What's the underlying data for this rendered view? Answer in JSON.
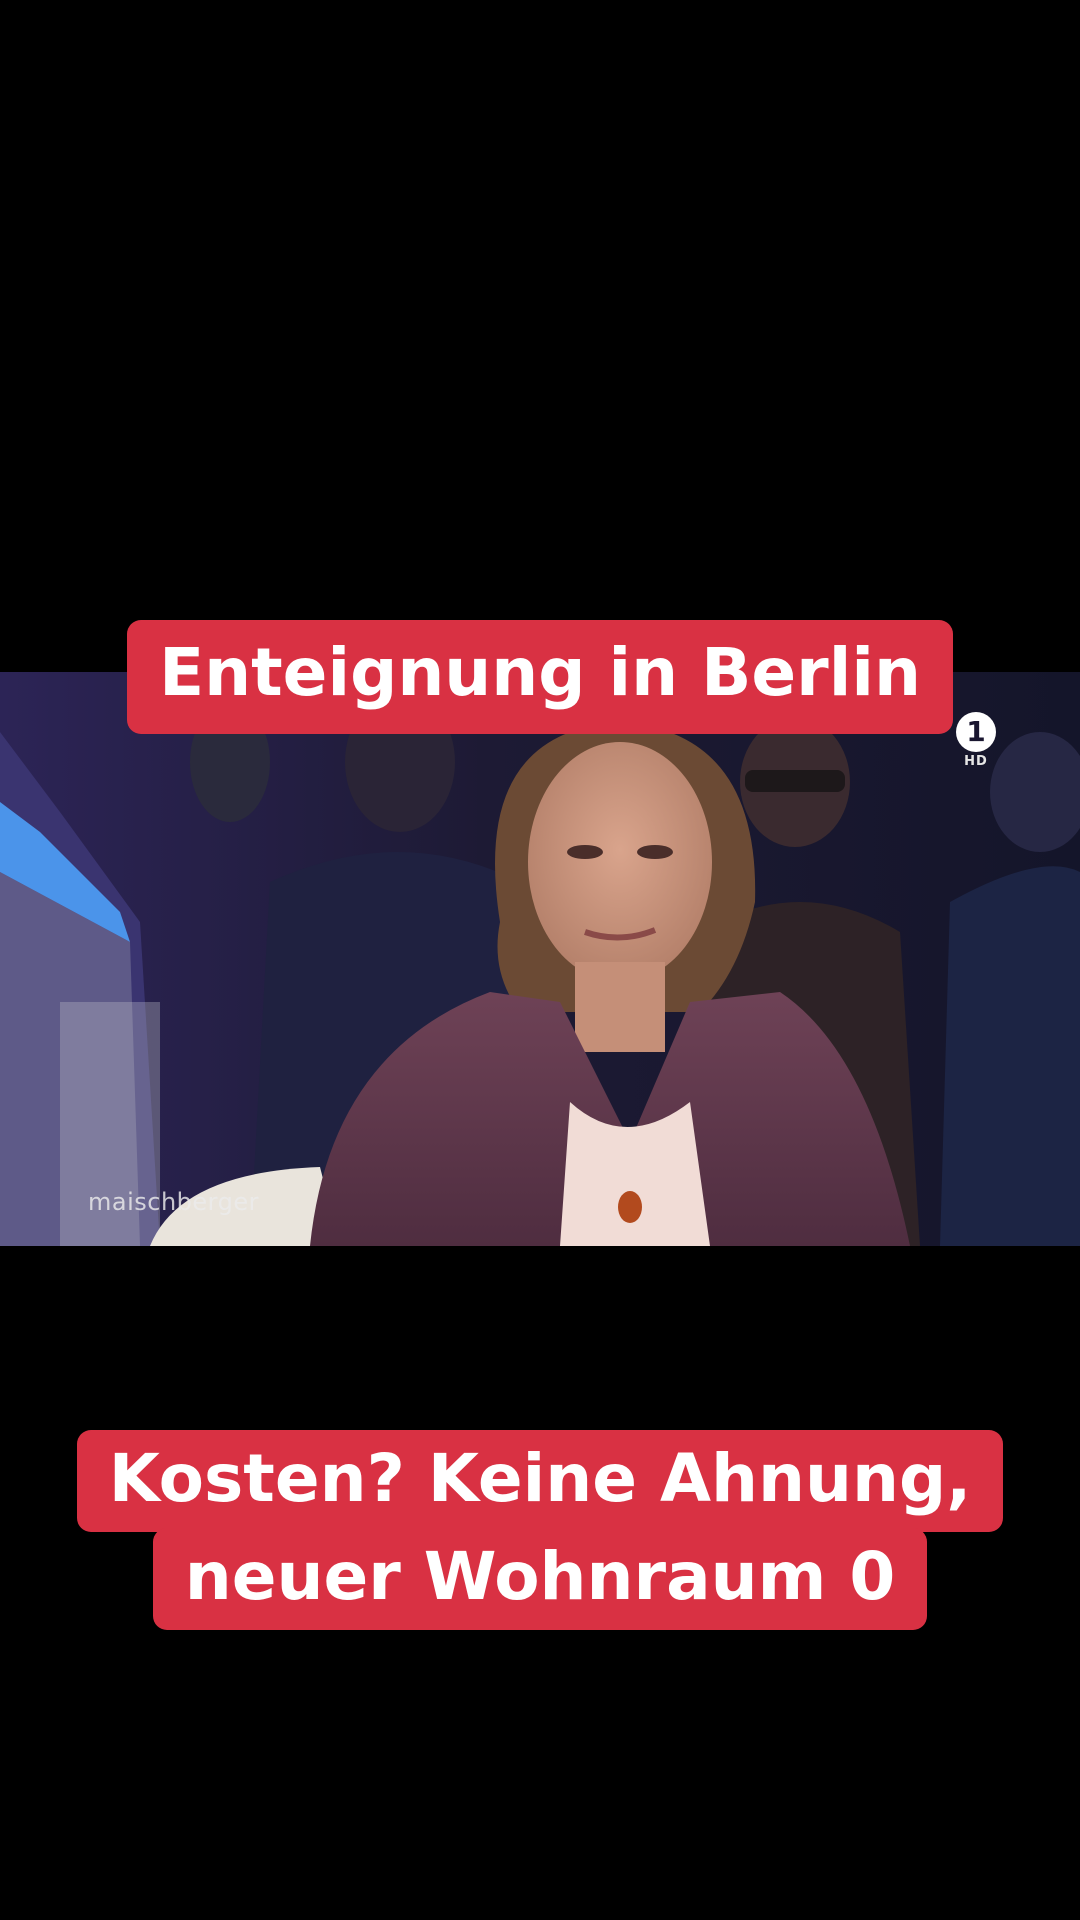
{
  "video": {
    "channel_logo_text": "1",
    "channel_hd_text": "HD",
    "show_logo_text": "maischberger"
  },
  "captions": {
    "top": "Enteignung in Berlin",
    "bottom_line1": "Kosten? Keine Ahnung,",
    "bottom_line2": "neuer Wohnraum 0"
  },
  "colors": {
    "caption_bg": "#d93143",
    "caption_text": "#ffffff",
    "page_bg": "#000000"
  }
}
